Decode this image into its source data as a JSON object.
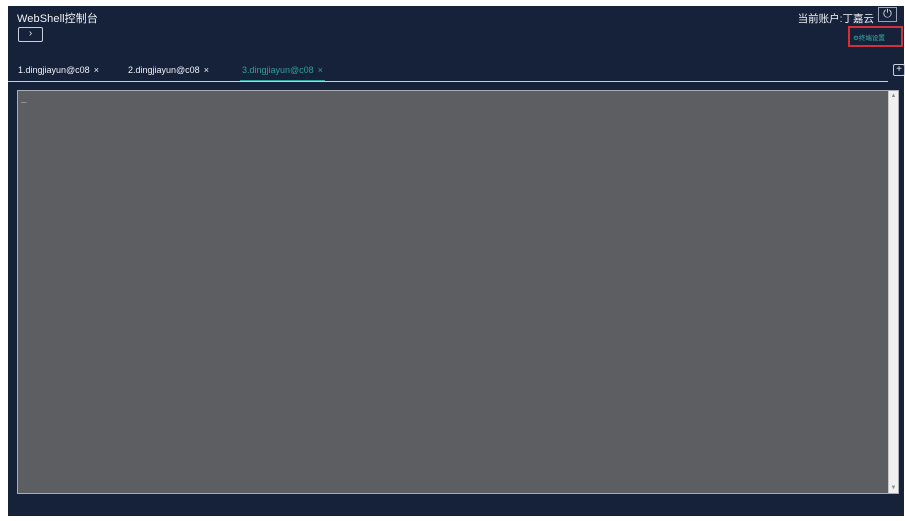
{
  "window": {
    "title": "WebShell控制台",
    "toggle_label": "›"
  },
  "account": {
    "text": "当前账户:丁嘉云",
    "power_icon": "⏻"
  },
  "settings": {
    "label": "⚙终端设置"
  },
  "tabs": [
    {
      "label": "1.dingjiayun@c08",
      "close": "×"
    },
    {
      "label": "2.dingjiayun@c08",
      "close": "×"
    },
    {
      "label": "3.dingjiayun@c08",
      "close": "×"
    }
  ],
  "add_tab": {
    "label": "+"
  },
  "terminal": {
    "cursor": "_"
  },
  "scrollbar": {
    "up": "▲",
    "down": "▼"
  },
  "colors": {
    "background": "#16213a",
    "terminal": "#5d5e62",
    "accent": "#2f9f9c",
    "highlight_box": "#d0323b"
  }
}
